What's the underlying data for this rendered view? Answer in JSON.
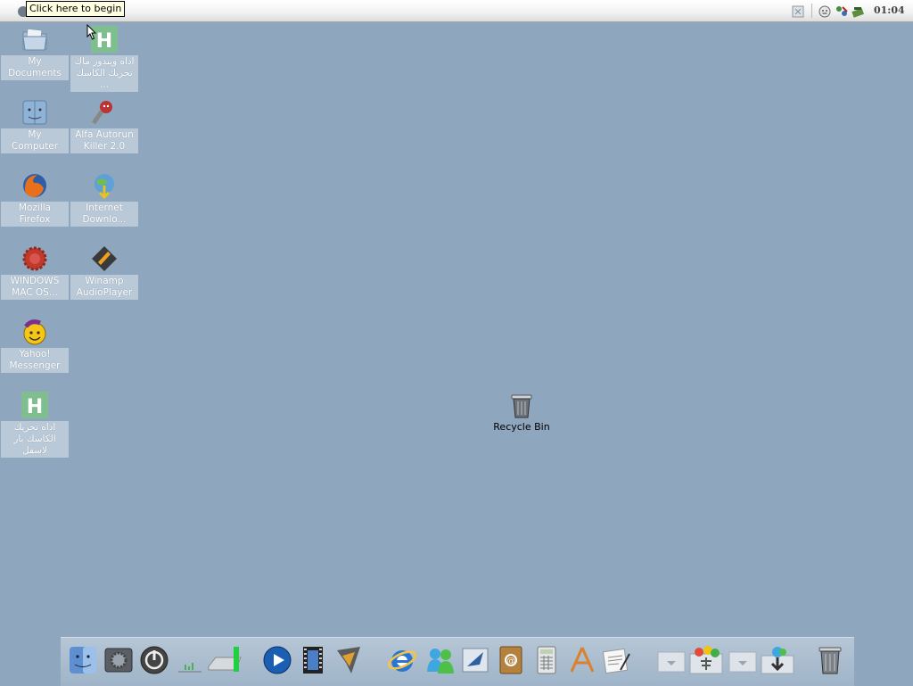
{
  "menubar": {
    "tooltip": "Click here to begin",
    "clock": "01:04",
    "tray_icons": [
      "tray-app-icon",
      "smiley-icon",
      "network-icon",
      "disk-icon"
    ]
  },
  "desktop": {
    "icons": [
      {
        "name": "my-documents",
        "label": "My Documents",
        "icon": "folder-icon"
      },
      {
        "name": "arabic-tool-1",
        "label": "اداه ويندوز ماك تحريك الكاسك ...",
        "icon": "h-app-icon"
      },
      {
        "name": "my-computer",
        "label": "My Computer",
        "icon": "finder-icon"
      },
      {
        "name": "alfa-autorun",
        "label": "Alfa Autorun Killer 2.0",
        "icon": "alfa-icon"
      },
      {
        "name": "mozilla-firefox",
        "label": "Mozilla Firefox",
        "icon": "firefox-icon"
      },
      {
        "name": "internet-download",
        "label": "Internet Downlo...",
        "icon": "idm-icon"
      },
      {
        "name": "windows-mac-os",
        "label": "WINDOWS MAC OS...",
        "icon": "gear-red-icon"
      },
      {
        "name": "winamp",
        "label": "Winamp AudioPlayer",
        "icon": "winamp-icon"
      },
      {
        "name": "yahoo-messenger",
        "label": "Yahoo! Messenger",
        "icon": "yahoo-icon"
      },
      {
        "name": "arabic-tool-2",
        "label": "اداه تحريك الكاسك بار لاسفل",
        "icon": "h-app-icon"
      }
    ],
    "recycle_bin": {
      "label": "Recycle Bin",
      "icon": "trash-icon"
    }
  },
  "dock": {
    "items": [
      "finder-icon",
      "system-preferences-icon",
      "power-icon",
      "activity-monitor-icon",
      "hard-drive-icon",
      "media-player-icon",
      "video-icon",
      "winamp-icon",
      "internet-explorer-icon",
      "messenger-icon",
      "mail-icon",
      "address-book-icon",
      "calculator-icon",
      "app-store-icon",
      "text-edit-icon",
      "stack-folder-icon",
      "downloads-icon",
      "trash-icon"
    ]
  },
  "colors": {
    "desktop": "#8ea7bf",
    "menubar": "#f1f1f1",
    "tooltip": "#ffffe1"
  }
}
